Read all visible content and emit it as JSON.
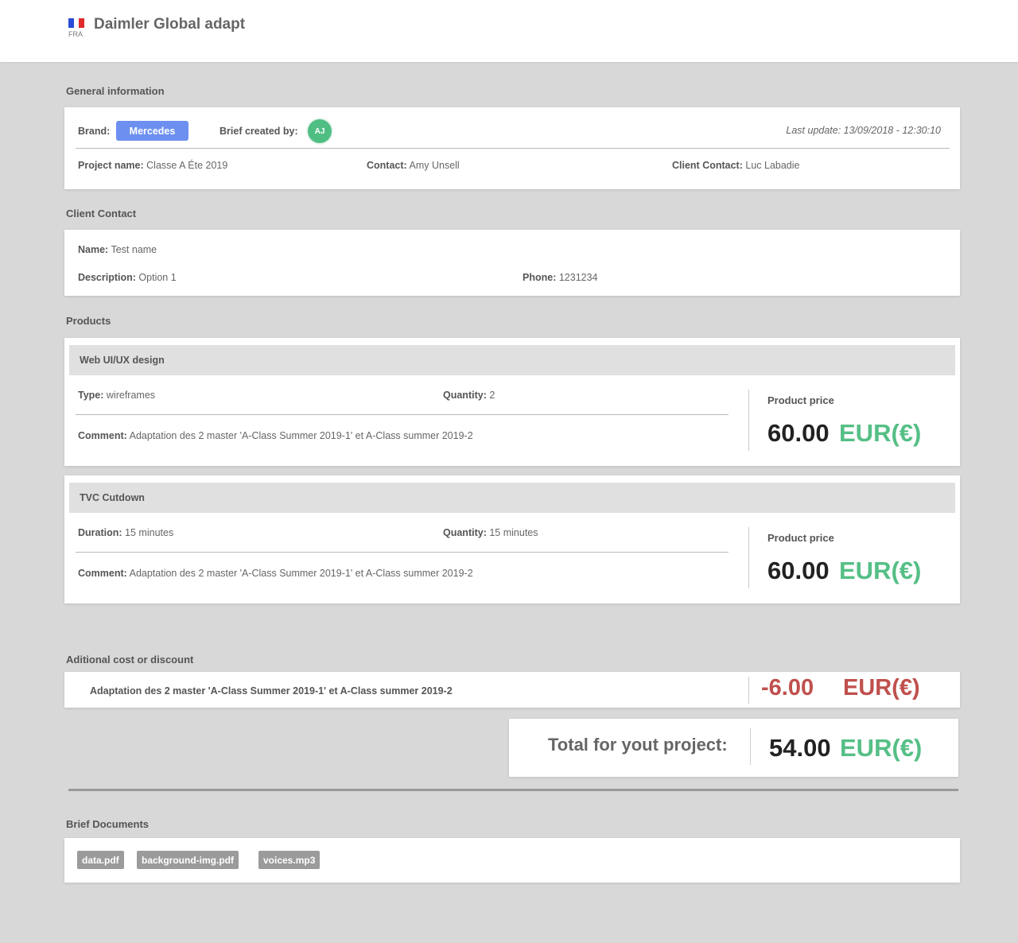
{
  "header": {
    "country_code": "FRA",
    "title": "Daimler Global adapt",
    "flag_colors": [
      "#2a4cd6",
      "#ffffff",
      "#e02b2b"
    ]
  },
  "general": {
    "section_title": "General information",
    "brand_label": "Brand:",
    "brand_value": "Mercedes",
    "created_by_label": "Brief created by:",
    "creator_initials": "AJ",
    "last_update": "Last update: 13/09/2018 - 12:30:10",
    "project_name_label": "Project name:",
    "project_name": "Classe A Éte 2019",
    "contact_label": "Contact:",
    "contact": "Amy Unsell",
    "client_contact_label": "Client Contact:",
    "client_contact": "Luc Labadie"
  },
  "client_contact": {
    "section_title": "Client Contact",
    "name_label": "Name:",
    "name": "Test name",
    "description_label": "Description:",
    "description": "Option 1",
    "phone_label": "Phone:",
    "phone": "1231234"
  },
  "products": {
    "section_title": "Products",
    "items": [
      {
        "title": "Web UI/UX design",
        "field1_label": "Type:",
        "field1_value": "wireframes",
        "quantity_label": "Quantity:",
        "quantity_value": "2",
        "comment_label": "Comment:",
        "comment": "Adaptation des 2 master 'A-Class Summer 2019-1' et A-Class summer 2019-2",
        "price_label": "Product price",
        "price": "60.00",
        "currency": "EUR(€)"
      },
      {
        "title": "TVC Cutdown",
        "field1_label": "Duration:",
        "field1_value": "15 minutes",
        "quantity_label": "Quantity:",
        "quantity_value": "15 minutes",
        "comment_label": "Comment:",
        "comment": "Adaptation des 2 master 'A-Class Summer 2019-1' et A-Class summer 2019-2",
        "price_label": "Product price",
        "price": "60.00",
        "currency": "EUR(€)"
      }
    ]
  },
  "additional": {
    "section_title": "Aditional cost or discount",
    "description": "Adaptation des 2 master 'A-Class Summer 2019-1' et A-Class summer 2019-2",
    "amount": "-6.00",
    "currency": "EUR(€)"
  },
  "total": {
    "label": "Total for yout project:",
    "amount": "54.00",
    "currency": "EUR(€)"
  },
  "documents": {
    "section_title": "Brief Documents",
    "files": [
      "data.pdf",
      "background-img.pdf",
      "voices.mp3"
    ]
  },
  "colors": {
    "brand_button": "#6d8ff0",
    "avatar": "#4fbe82",
    "currency_green": "#55bf86",
    "negative_red": "#c0504d"
  }
}
